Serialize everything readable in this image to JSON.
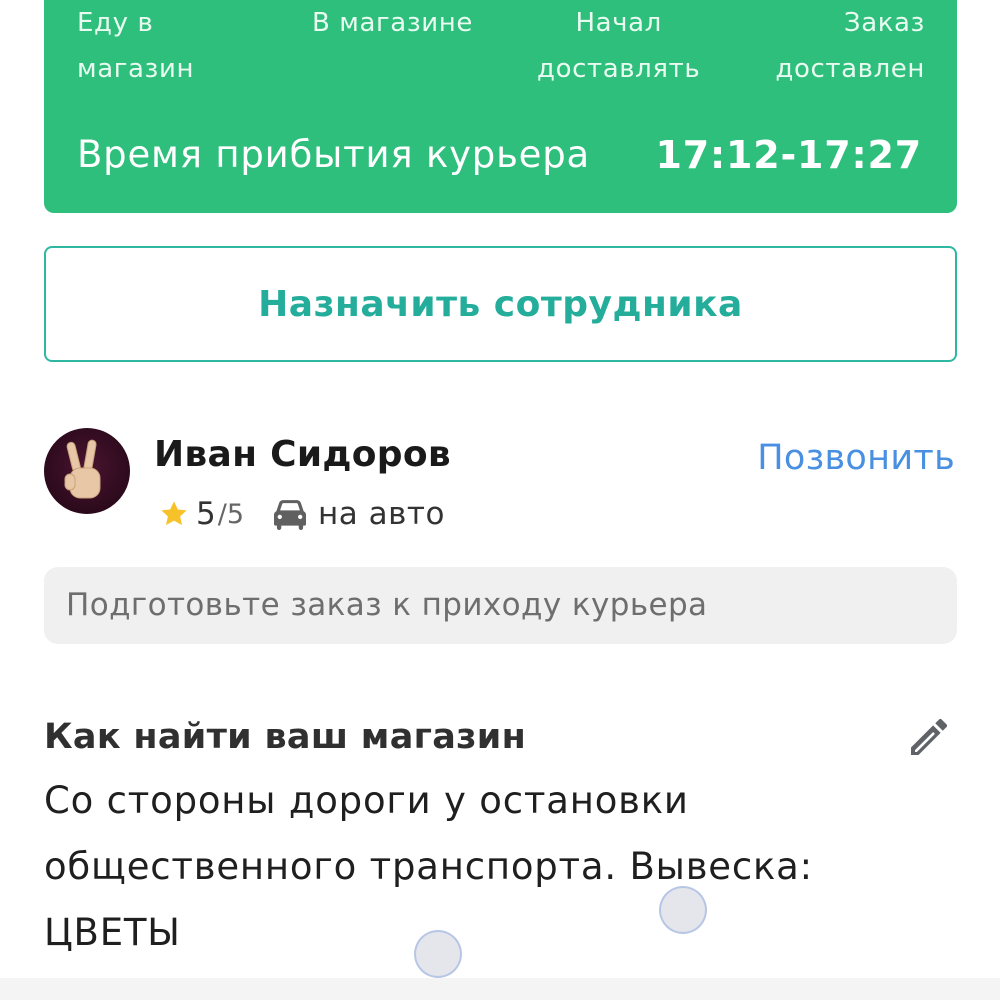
{
  "status": {
    "steps": [
      {
        "line1": "Еду в",
        "line2": "магазин"
      },
      {
        "line1": "В магазине",
        "line2": ""
      },
      {
        "line1": "Начал",
        "line2": "доставлять"
      },
      {
        "line1": "Заказ",
        "line2": "доставлен"
      }
    ],
    "arrival_label": "Время прибытия курьера",
    "arrival_time": "17:12-17:27",
    "color": "#2ebf7c"
  },
  "assign_button": {
    "label": "Назначить сотрудника",
    "color": "#23ad9a"
  },
  "courier": {
    "name": "Иван Сидоров",
    "call_label": "Позвонить",
    "rating": "5",
    "rating_max": "/5",
    "vehicle": "на авто",
    "avatar_icon": "victory-hand-icon",
    "rating_icon": "star-icon",
    "vehicle_icon": "car-icon",
    "link_color": "#4a90e2"
  },
  "note": {
    "text": "Подготовьте заказ к приходу курьера"
  },
  "store_directions": {
    "title": "Как найти ваш магазин",
    "line1": "Со стороны дороги у остановки",
    "line2": "общественного транспорта. Вывеска:",
    "line3": "ЦВЕТЫ",
    "edit_icon": "pencil-icon"
  }
}
